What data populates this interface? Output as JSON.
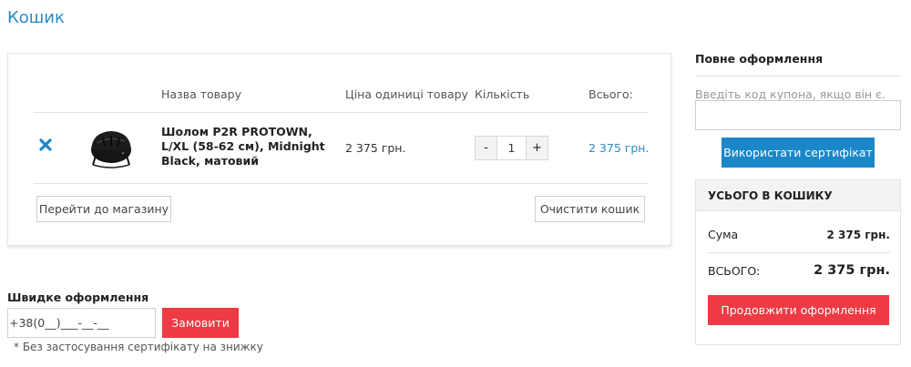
{
  "page": {
    "title": "Кошик"
  },
  "cart": {
    "columns": {
      "name": "Назва товару",
      "price": "Ціна одиниці товару",
      "qty": "Кількість",
      "total": "Всього:"
    },
    "items": [
      {
        "name": "Шолом P2R PROTOWN, L/XL (58-62 см), Midnight Black, матовий",
        "price": "2 375 грн.",
        "qty_minus": "-",
        "qty": "1",
        "qty_plus": "+",
        "total": "2 375 грн."
      }
    ],
    "continue_shopping_label": "Перейти до магазину",
    "clear_cart_label": "Очистити кошик"
  },
  "quick_checkout": {
    "title": "Швидке оформлення",
    "phone_value": "+38(0__)___-__-__",
    "order_label": "Замовити",
    "note": "* Без застосування сертифікату на знижку"
  },
  "full_checkout": {
    "title": "Повне оформлення",
    "coupon_label": "Введіть код купона, якщо він є.",
    "coupon_value": "",
    "apply_label": "Використати сертифікат"
  },
  "totals": {
    "header": "УСЬОГО В КОШИКУ",
    "sum_label": "Сума",
    "sum_value": "2 375 грн.",
    "total_label": "ВСЬОГО:",
    "total_value": "2 375 грн.",
    "continue_label": "Продовжити оформлення"
  },
  "colors": {
    "accent_blue": "#1a87c9",
    "link_blue": "#2a8bc6",
    "action_red": "#ee3a44"
  },
  "icons": {
    "remove": "close-x-icon",
    "product": "helmet-image"
  }
}
